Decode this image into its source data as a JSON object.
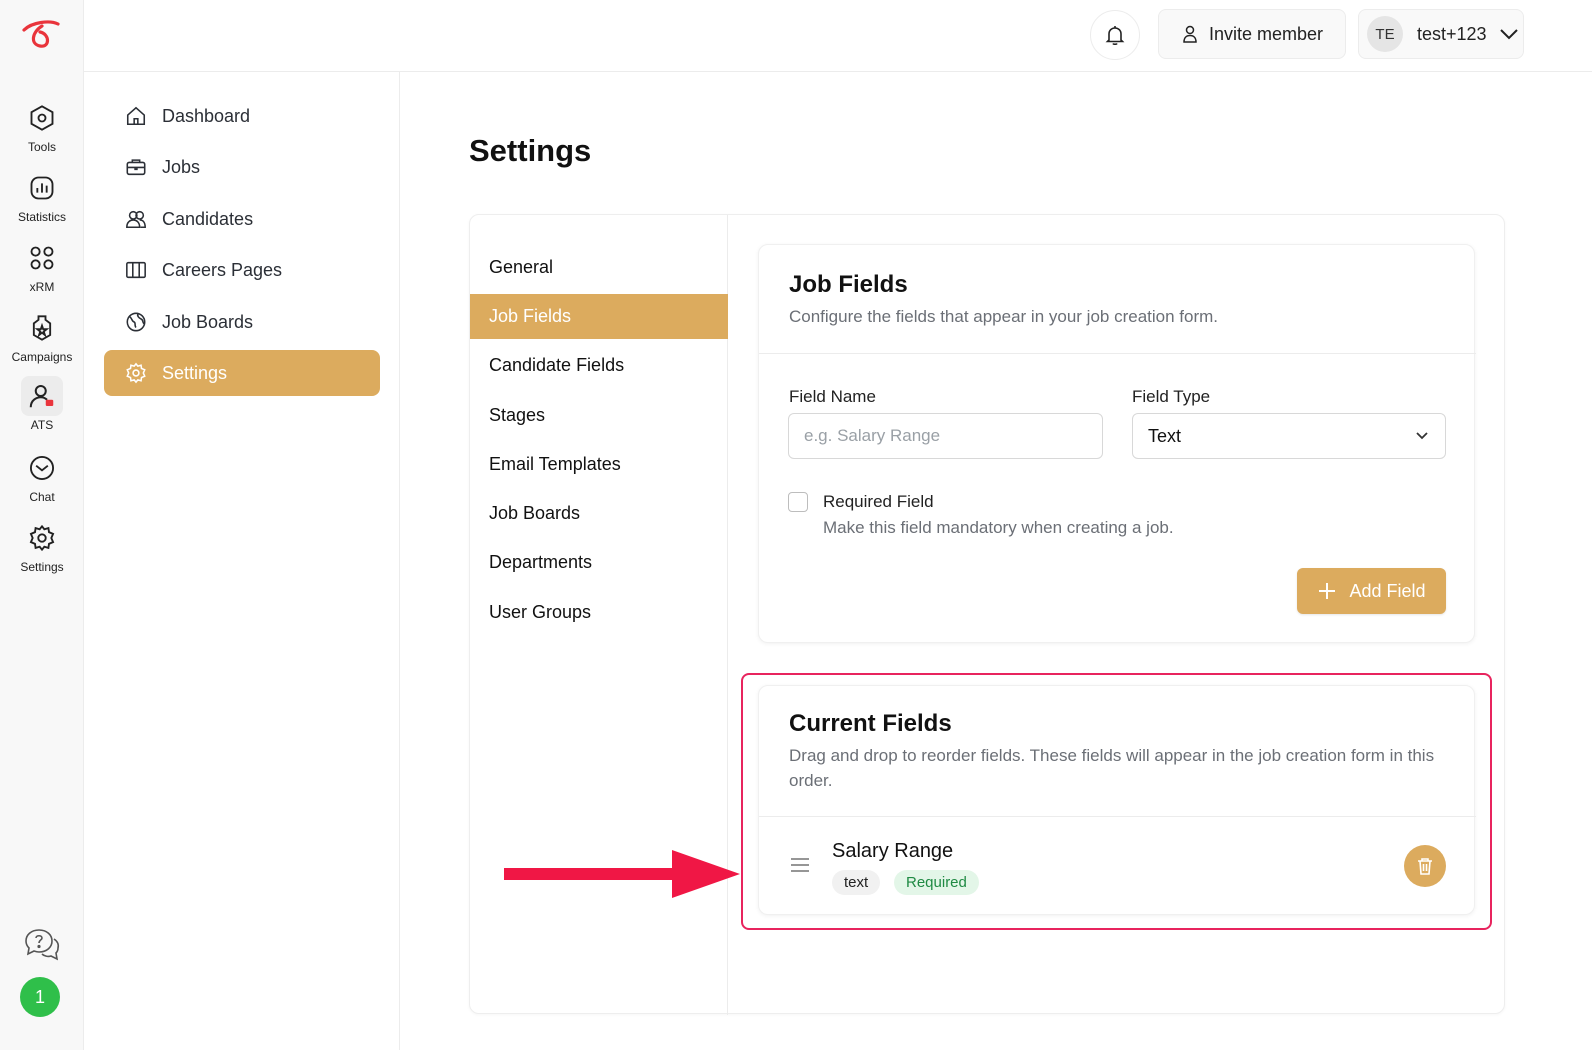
{
  "rail": {
    "items": [
      {
        "label": "Tools",
        "icon": "hexagon-icon"
      },
      {
        "label": "Statistics",
        "icon": "bar-chart-icon"
      },
      {
        "label": "xRM",
        "icon": "grid-icon"
      },
      {
        "label": "Campaigns",
        "icon": "badge-star-icon"
      },
      {
        "label": "ATS",
        "icon": "user-tag-icon"
      },
      {
        "label": "Chat",
        "icon": "chat-icon"
      },
      {
        "label": "Settings",
        "icon": "gear-icon"
      }
    ],
    "badge": "1"
  },
  "nav": {
    "items": [
      {
        "label": "Dashboard",
        "icon": "home-icon"
      },
      {
        "label": "Jobs",
        "icon": "briefcase-icon"
      },
      {
        "label": "Candidates",
        "icon": "users-icon"
      },
      {
        "label": "Careers Pages",
        "icon": "columns-icon"
      },
      {
        "label": "Job Boards",
        "icon": "globe-icon"
      },
      {
        "label": "Settings",
        "icon": "gear-icon"
      }
    ]
  },
  "topbar": {
    "invite_label": "Invite member",
    "user_initials": "TE",
    "user_name": "test+123"
  },
  "page": {
    "title": "Settings"
  },
  "subnav": {
    "items": [
      "General",
      "Job Fields",
      "Candidate Fields",
      "Stages",
      "Email Templates",
      "Job Boards",
      "Departments",
      "User Groups"
    ]
  },
  "job_fields": {
    "title": "Job Fields",
    "subtitle": "Configure the fields that appear in your job creation form.",
    "field_name_label": "Field Name",
    "field_name_placeholder": "e.g. Salary Range",
    "field_type_label": "Field Type",
    "field_type_value": "Text",
    "required_label": "Required Field",
    "required_desc": "Make this field mandatory when creating a job.",
    "add_button": "Add Field"
  },
  "current_fields": {
    "title": "Current Fields",
    "subtitle": "Drag and drop to reorder fields. These fields will appear in the job creation form in this order.",
    "rows": [
      {
        "name": "Salary Range",
        "type": "text",
        "required": "Required"
      }
    ]
  },
  "colors": {
    "accent": "#dcab5e",
    "highlight": "#e8245e",
    "success": "#2fbf4a"
  }
}
